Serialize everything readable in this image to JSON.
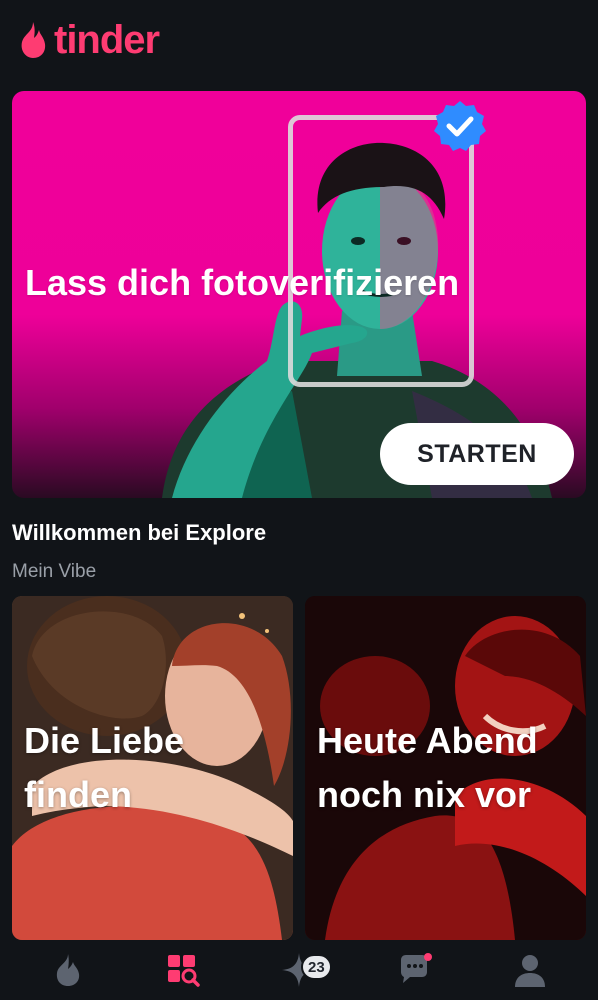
{
  "app": {
    "logo_text": "tinder",
    "brand_color": "#fe3c72",
    "background": "#111418"
  },
  "hero": {
    "title": "Lass dich fotoverifizieren",
    "cta_label": "STARTEN",
    "background_color": "#f0009a",
    "badge_icon": "verified-check-icon",
    "badge_color": "#2f8cff"
  },
  "explore": {
    "title": "Willkommen bei Explore",
    "subtitle": "Mein Vibe",
    "cards": [
      {
        "label": "Die Liebe finden"
      },
      {
        "label": "Heute Abend noch nix vor"
      }
    ]
  },
  "bottom_nav": {
    "items": [
      {
        "icon": "flame-icon",
        "active": false
      },
      {
        "icon": "explore-icon",
        "active": true
      },
      {
        "icon": "sparkle-icon",
        "active": false,
        "badge": "23"
      },
      {
        "icon": "chat-icon",
        "active": false
      },
      {
        "icon": "profile-icon",
        "active": false
      }
    ],
    "active_color": "#fe3c72",
    "inactive_color": "#5d6470"
  }
}
